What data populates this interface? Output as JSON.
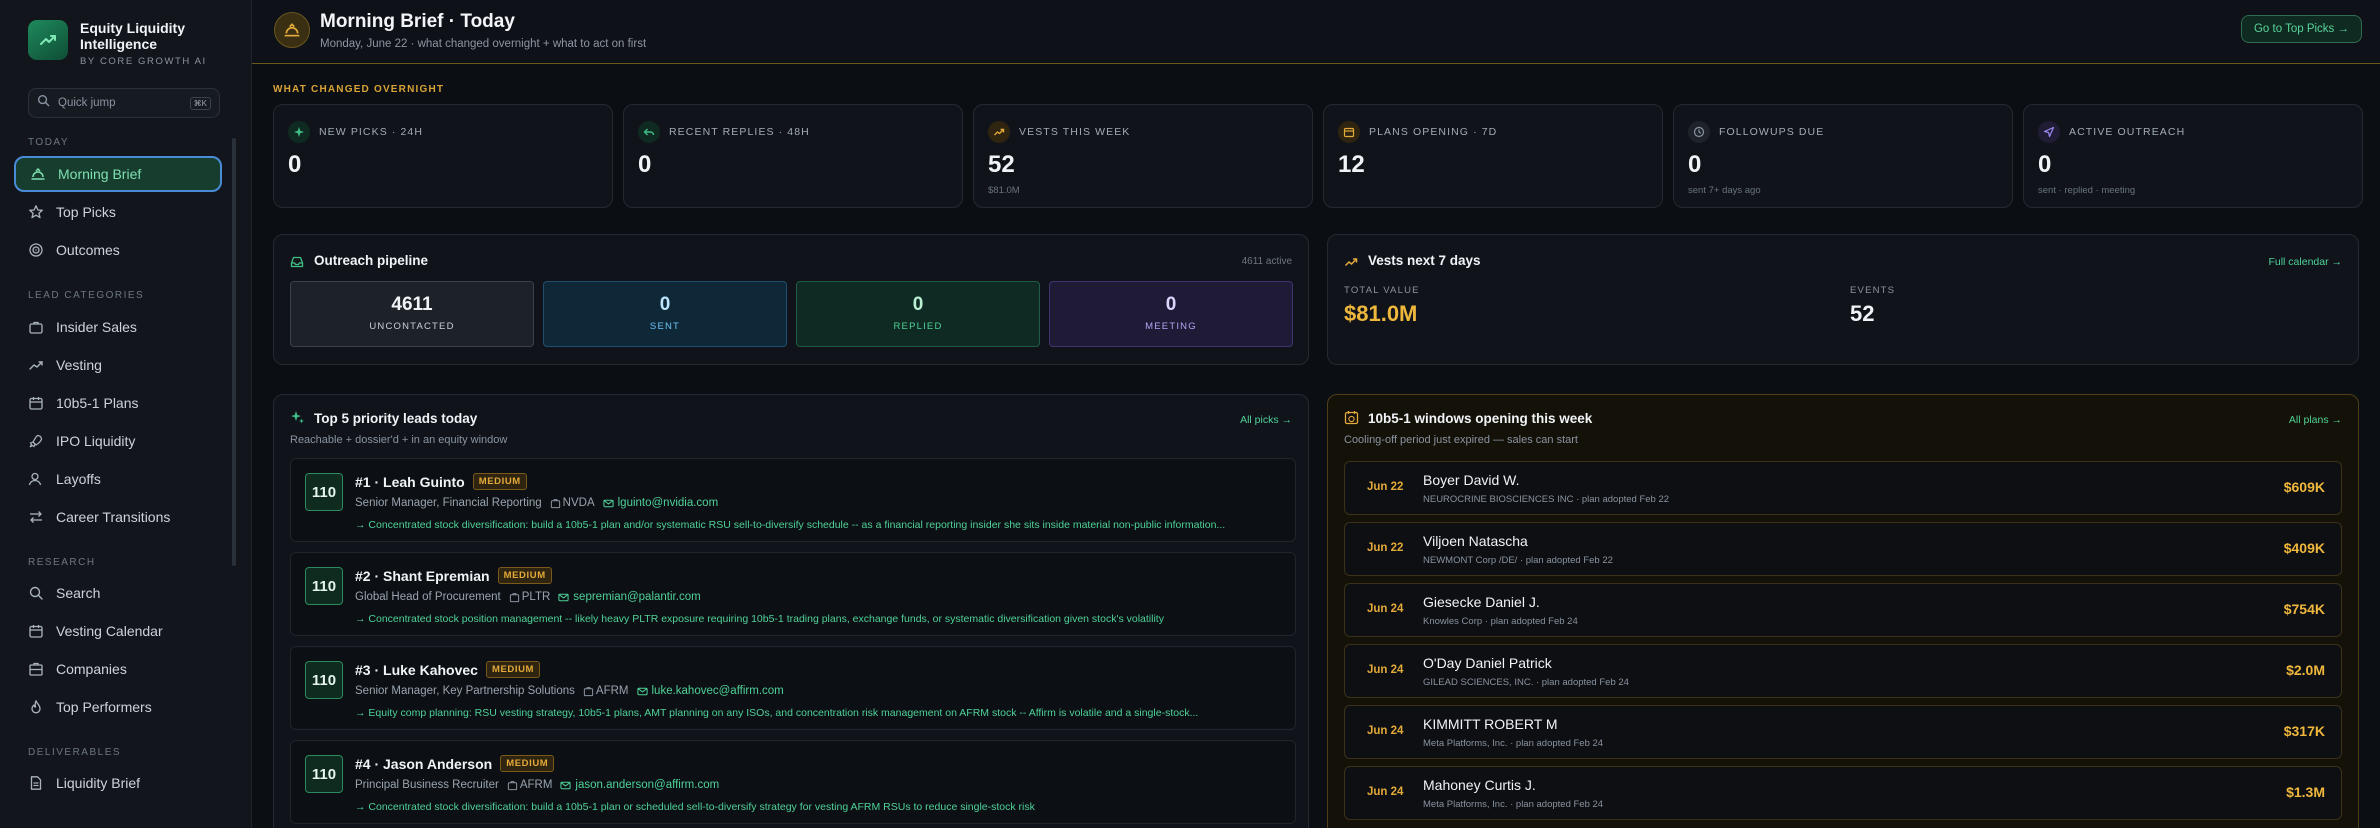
{
  "brand": {
    "title": "Equity Liquidity Intelligence",
    "subtitle": "BY CORE GROWTH AI"
  },
  "quick_jump": {
    "placeholder": "Quick jump",
    "shortcut": "⌘K"
  },
  "sidebar": {
    "sections": {
      "today": "TODAY",
      "lead_categories": "LEAD CATEGORIES",
      "research": "RESEARCH",
      "deliverables": "DELIVERABLES"
    },
    "today": [
      {
        "label": "Morning Brief",
        "icon": "sunrise-icon",
        "active": true
      },
      {
        "label": "Top Picks",
        "icon": "star-icon"
      },
      {
        "label": "Outcomes",
        "icon": "target-icon"
      }
    ],
    "lead_categories": [
      {
        "label": "Insider Sales",
        "icon": "briefcase-icon"
      },
      {
        "label": "Vesting",
        "icon": "trend-up-icon"
      },
      {
        "label": "10b5-1 Plans",
        "icon": "calendar-icon"
      },
      {
        "label": "IPO Liquidity",
        "icon": "rocket-icon"
      },
      {
        "label": "Layoffs",
        "icon": "user-minus-icon"
      },
      {
        "label": "Career Transitions",
        "icon": "arrows-swap-icon"
      }
    ],
    "research": [
      {
        "label": "Search",
        "icon": "search-icon"
      },
      {
        "label": "Vesting Calendar",
        "icon": "calendar-icon"
      },
      {
        "label": "Companies",
        "icon": "building-icon"
      },
      {
        "label": "Top Performers",
        "icon": "flame-icon"
      }
    ],
    "deliverables": [
      {
        "label": "Liquidity Brief",
        "icon": "document-icon"
      }
    ]
  },
  "header": {
    "title": "Morning Brief · Today",
    "subtitle": "Monday, June 22 · what changed overnight + what to act on first",
    "button": "Go to Top Picks →"
  },
  "overnight": {
    "heading": "WHAT CHANGED OVERNIGHT",
    "stats": [
      {
        "label": "NEW PICKS · 24H",
        "value": "0",
        "sub": "",
        "icon": "sparkle-icon",
        "color": "#3fbf85"
      },
      {
        "label": "RECENT REPLIES · 48H",
        "value": "0",
        "sub": "",
        "icon": "reply-icon",
        "color": "#3fbf85"
      },
      {
        "label": "VESTS THIS WEEK",
        "value": "52",
        "sub": "$81.0M",
        "icon": "trend-up-icon",
        "color": "#e3a93a"
      },
      {
        "label": "PLANS OPENING · 7D",
        "value": "12",
        "sub": "",
        "icon": "calendar-icon",
        "color": "#e3a93a"
      },
      {
        "label": "FOLLOWUPS DUE",
        "value": "0",
        "sub": "sent 7+ days ago",
        "icon": "clock-icon",
        "color": "#8a93a0"
      },
      {
        "label": "ACTIVE OUTREACH",
        "value": "0",
        "sub": "sent · replied · meeting",
        "icon": "send-icon",
        "color": "#9a8cf0"
      }
    ]
  },
  "pipeline": {
    "title": "Outreach pipeline",
    "meta": "4611 active",
    "stages": [
      {
        "value": "4611",
        "label": "UNCONTACTED"
      },
      {
        "value": "0",
        "label": "SENT"
      },
      {
        "value": "0",
        "label": "REPLIED"
      },
      {
        "value": "0",
        "label": "MEETING"
      }
    ]
  },
  "vests": {
    "title": "Vests next 7 days",
    "link": "Full calendar →",
    "total_label": "TOTAL VALUE",
    "total_value": "$81.0M",
    "events_label": "EVENTS",
    "events_value": "52"
  },
  "priority": {
    "title": "Top 5 priority leads today",
    "subtitle": "Reachable + dossier'd + in an equity window",
    "link": "All picks →",
    "leads": [
      {
        "score": "110",
        "name": "#1 · Leah Guinto",
        "level": "MEDIUM",
        "role": "Senior Manager, Financial Reporting",
        "ticker": "NVDA",
        "email": "lguinto@nvidia.com",
        "note": "→ Concentrated stock diversification: build a 10b5-1 plan and/or systematic RSU sell-to-diversify schedule -- as a financial reporting insider she sits inside material non-public information..."
      },
      {
        "score": "110",
        "name": "#2 · Shant Epremian",
        "level": "MEDIUM",
        "role": "Global Head of Procurement",
        "ticker": "PLTR",
        "email": "sepremian@palantir.com",
        "note": "→ Concentrated stock position management -- likely heavy PLTR exposure requiring 10b5-1 trading plans, exchange funds, or systematic diversification given stock's volatility"
      },
      {
        "score": "110",
        "name": "#3 · Luke Kahovec",
        "level": "MEDIUM",
        "role": "Senior Manager, Key Partnership Solutions",
        "ticker": "AFRM",
        "email": "luke.kahovec@affirm.com",
        "note": "→ Equity comp planning: RSU vesting strategy, 10b5-1 plans, AMT planning on any ISOs, and concentration risk management on AFRM stock -- Affirm is volatile and a single-stock..."
      },
      {
        "score": "110",
        "name": "#4 · Jason Anderson",
        "level": "MEDIUM",
        "role": "Principal Business Recruiter",
        "ticker": "AFRM",
        "email": "jason.anderson@affirm.com",
        "note": "→ Concentrated stock diversification: build a 10b5-1 plan or scheduled sell-to-diversify strategy for vesting AFRM RSUs to reduce single-stock risk"
      }
    ]
  },
  "windows": {
    "title": "10b5-1 windows opening this week",
    "subtitle": "Cooling-off period just expired — sales can start",
    "link": "All plans →",
    "rows": [
      {
        "date": "Jun 22",
        "name": "Boyer David W.",
        "company": "NEUROCRINE BIOSCIENCES INC · plan adopted Feb 22",
        "amount": "$609K"
      },
      {
        "date": "Jun 22",
        "name": "Viljoen Natascha",
        "company": "NEWMONT Corp /DE/ · plan adopted Feb 22",
        "amount": "$409K"
      },
      {
        "date": "Jun 24",
        "name": "Giesecke Daniel J.",
        "company": "Knowles Corp · plan adopted Feb 24",
        "amount": "$754K"
      },
      {
        "date": "Jun 24",
        "name": "O'Day Daniel Patrick",
        "company": "GILEAD SCIENCES, INC. · plan adopted Feb 24",
        "amount": "$2.0M"
      },
      {
        "date": "Jun 24",
        "name": "KIMMITT ROBERT M",
        "company": "Meta Platforms, Inc. · plan adopted Feb 24",
        "amount": "$317K"
      },
      {
        "date": "Jun 24",
        "name": "Mahoney Curtis J.",
        "company": "Meta Platforms, Inc. · plan adopted Feb 24",
        "amount": "$1.3M"
      }
    ]
  }
}
